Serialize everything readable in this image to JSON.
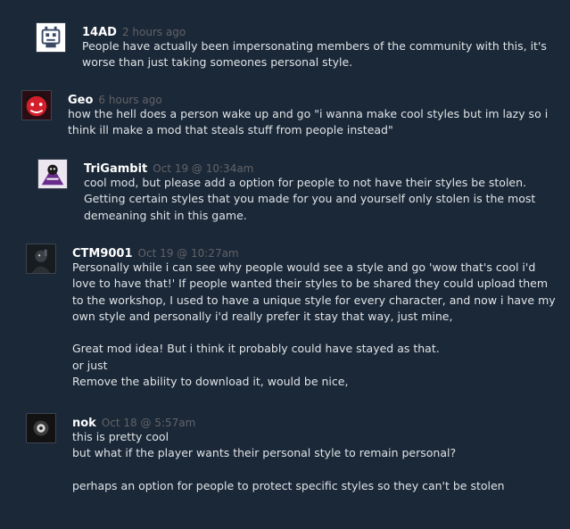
{
  "comments": [
    {
      "author": "14AD",
      "time": "2 hours ago",
      "text": "People have actually been impersonating members of the community with this, it's\nworse than just taking someones personal style."
    },
    {
      "author": "Geo",
      "time": "6 hours ago",
      "text": "how the hell does a person wake up and go \"i wanna make cool styles but im lazy so i\nthink ill make a mod that steals stuff from people instead\""
    },
    {
      "author": "TriGambit",
      "time": "Oct 19 @ 10:34am",
      "text": "cool mod, but please add a option for people to not have their styles be stolen.\nGetting certain styles that you made for you and yourself only stolen is the most\ndemeaning shit in this game."
    },
    {
      "author": "CTM9001",
      "time": "Oct 19 @ 10:27am",
      "text": "Personally while i can see why people would see a style and go 'wow that's cool i'd\nlove to have that!' If people wanted their styles to be shared they could upload them\nto the workshop, I used to have a unique style for every character, and now i have my\nown style and personally i'd really prefer it stay that way, just mine,\n\nGreat mod idea! But i think it probably could have stayed as that.\nor just\nRemove the ability to download it, would be nice,"
    },
    {
      "author": "nok",
      "time": "Oct 18 @ 5:57am",
      "text": "this is pretty cool\nbut what if the player wants their personal style to remain personal?\n\nperhaps an option for people to protect specific styles so they can't be stolen"
    }
  ]
}
